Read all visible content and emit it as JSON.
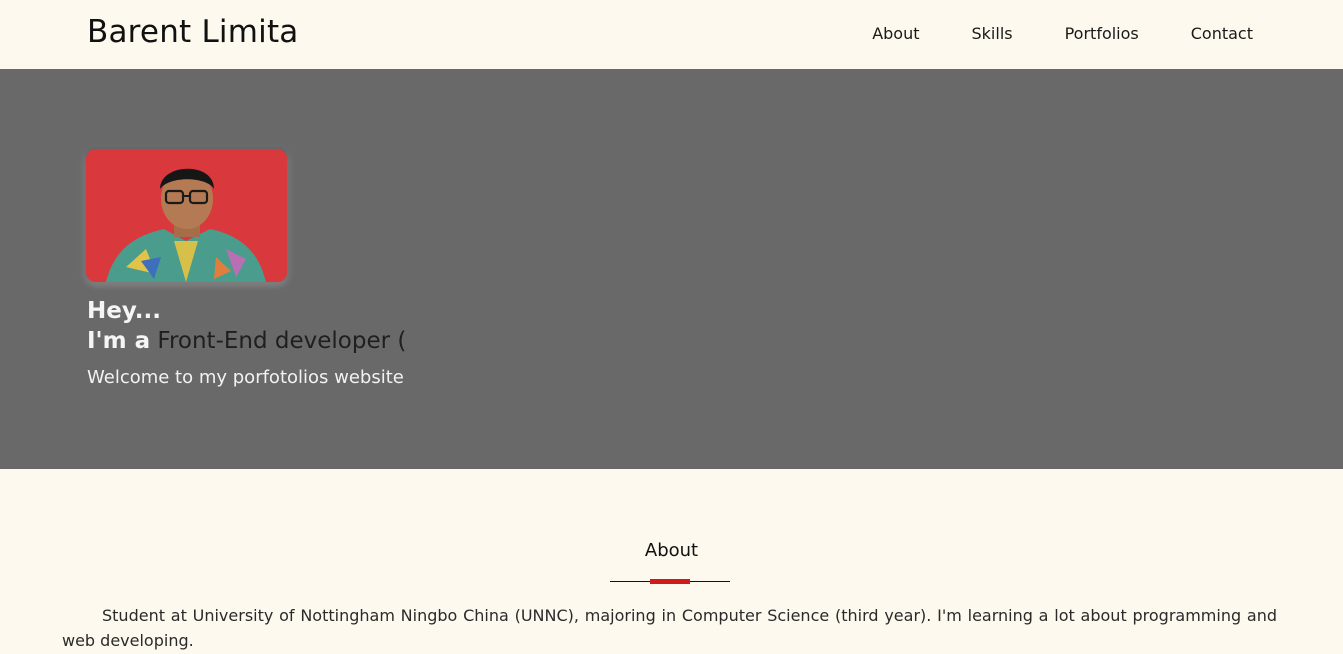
{
  "brand": "Barent Limita",
  "nav": {
    "items": [
      "About",
      "Skills",
      "Portfolios",
      "Contact"
    ]
  },
  "hero": {
    "greeting": "Hey...",
    "role_prefix": "I'm a",
    "role": "Front-End developer (",
    "welcome": "Welcome to my porfotolios website",
    "background_color": "#696969"
  },
  "about": {
    "title": "About",
    "accent_color": "#d11a1a",
    "text": "Student at University of Nottingham Ningbo China (UNNC), majoring in Computer Science (third year). I'm learning a lot about programming and web developing."
  }
}
